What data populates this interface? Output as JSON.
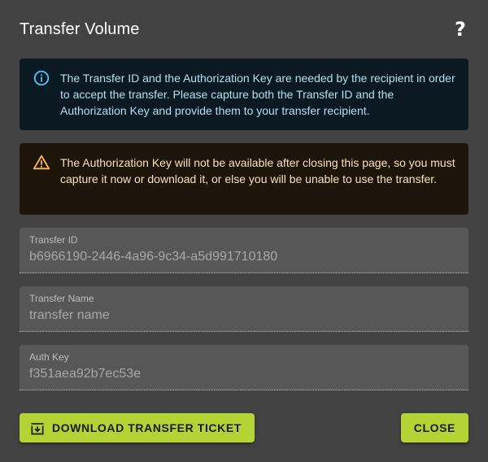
{
  "dialog": {
    "title": "Transfer Volume",
    "help_label": "?"
  },
  "alerts": {
    "info": {
      "icon": "info-circle-icon",
      "color": "#4fc3f7",
      "text": "The Transfer ID and the Authorization Key are needed by the recipient in order to accept the transfer. Please capture both the Transfer ID and the Authorization Key and provide them to your transfer recipient."
    },
    "warning": {
      "icon": "warning-triangle-icon",
      "color": "#ffb74d",
      "text": "The Authorization Key will not be available after closing this page, so you must capture it now or download it, or else you will be unable to use the transfer."
    }
  },
  "fields": {
    "transfer_id": {
      "label": "Transfer ID",
      "value": "b6966190-2446-4a96-9c34-a5d991710180"
    },
    "transfer_name": {
      "label": "Transfer Name",
      "value": "transfer name"
    },
    "auth_key": {
      "label": "Auth Key",
      "value": "f351aea92b7ec53e"
    }
  },
  "actions": {
    "download_label": "Download Transfer Ticket",
    "download_icon": "download-box-icon",
    "close_label": "Close",
    "accent_color": "#b5d334"
  }
}
